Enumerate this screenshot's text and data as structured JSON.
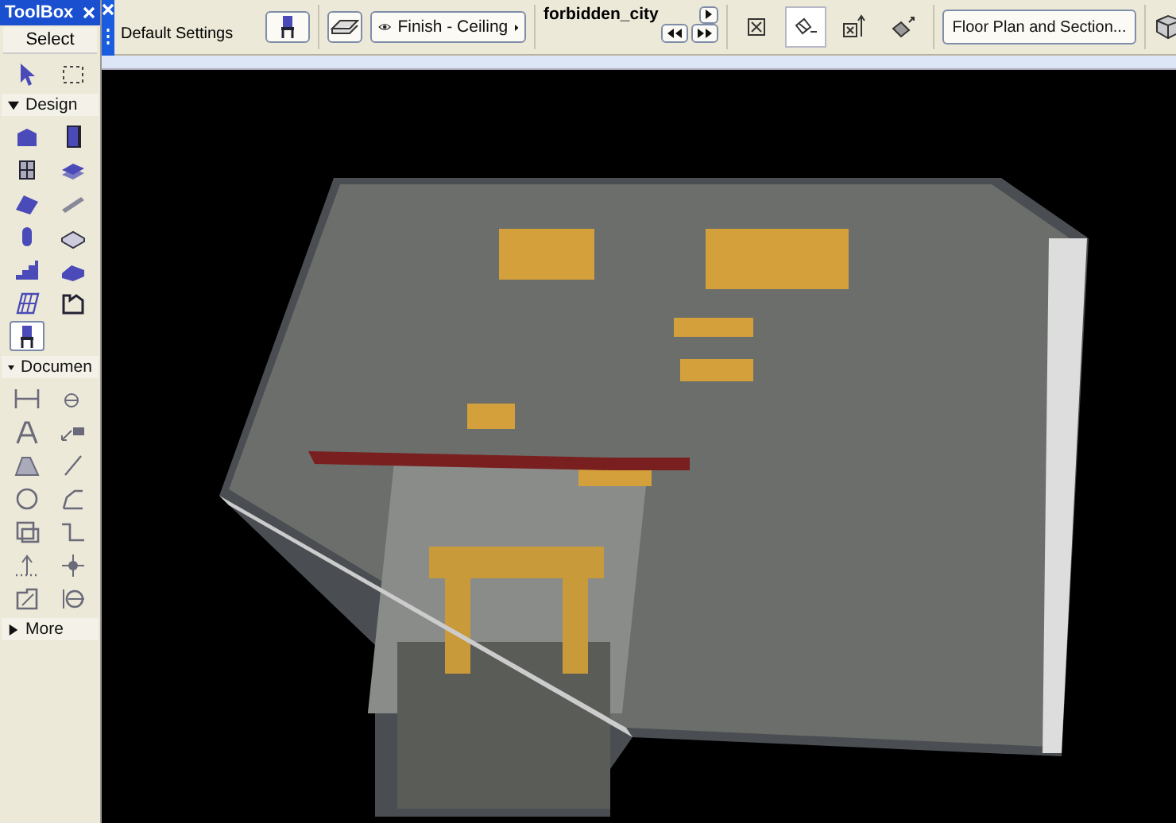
{
  "toolbox": {
    "title": "ToolBox",
    "select_label": "Select",
    "sections": [
      {
        "label": "Design",
        "expanded": true,
        "tools": [
          {
            "selected": false
          },
          {
            "selected": false
          },
          {
            "selected": false
          },
          {
            "selected": false
          },
          {
            "selected": false
          },
          {
            "selected": false
          },
          {
            "selected": false
          },
          {
            "selected": false
          },
          {
            "selected": false
          },
          {
            "selected": false
          },
          {
            "selected": false
          },
          {
            "selected": false
          },
          {
            "selected": true
          }
        ]
      },
      {
        "label": "Documen",
        "expanded": true,
        "tools": [
          {
            "selected": false
          },
          {
            "selected": false
          },
          {
            "selected": false
          },
          {
            "selected": false
          },
          {
            "selected": false
          },
          {
            "selected": false
          },
          {
            "selected": false
          },
          {
            "selected": false
          },
          {
            "selected": false
          },
          {
            "selected": false
          },
          {
            "selected": false
          },
          {
            "selected": false
          },
          {
            "selected": false
          },
          {
            "selected": false
          }
        ]
      },
      {
        "label": "More",
        "expanded": false
      }
    ]
  },
  "info_box": {
    "settings_label": "Default Settings",
    "finish_dropdown": "Finish - Ceiling",
    "project_name": "forbidden_city",
    "view_toggles": [
      {
        "selected": false
      },
      {
        "selected": true
      },
      {
        "selected": false
      },
      {
        "selected": false
      }
    ],
    "view_button": "Floor Plan and Section..."
  }
}
